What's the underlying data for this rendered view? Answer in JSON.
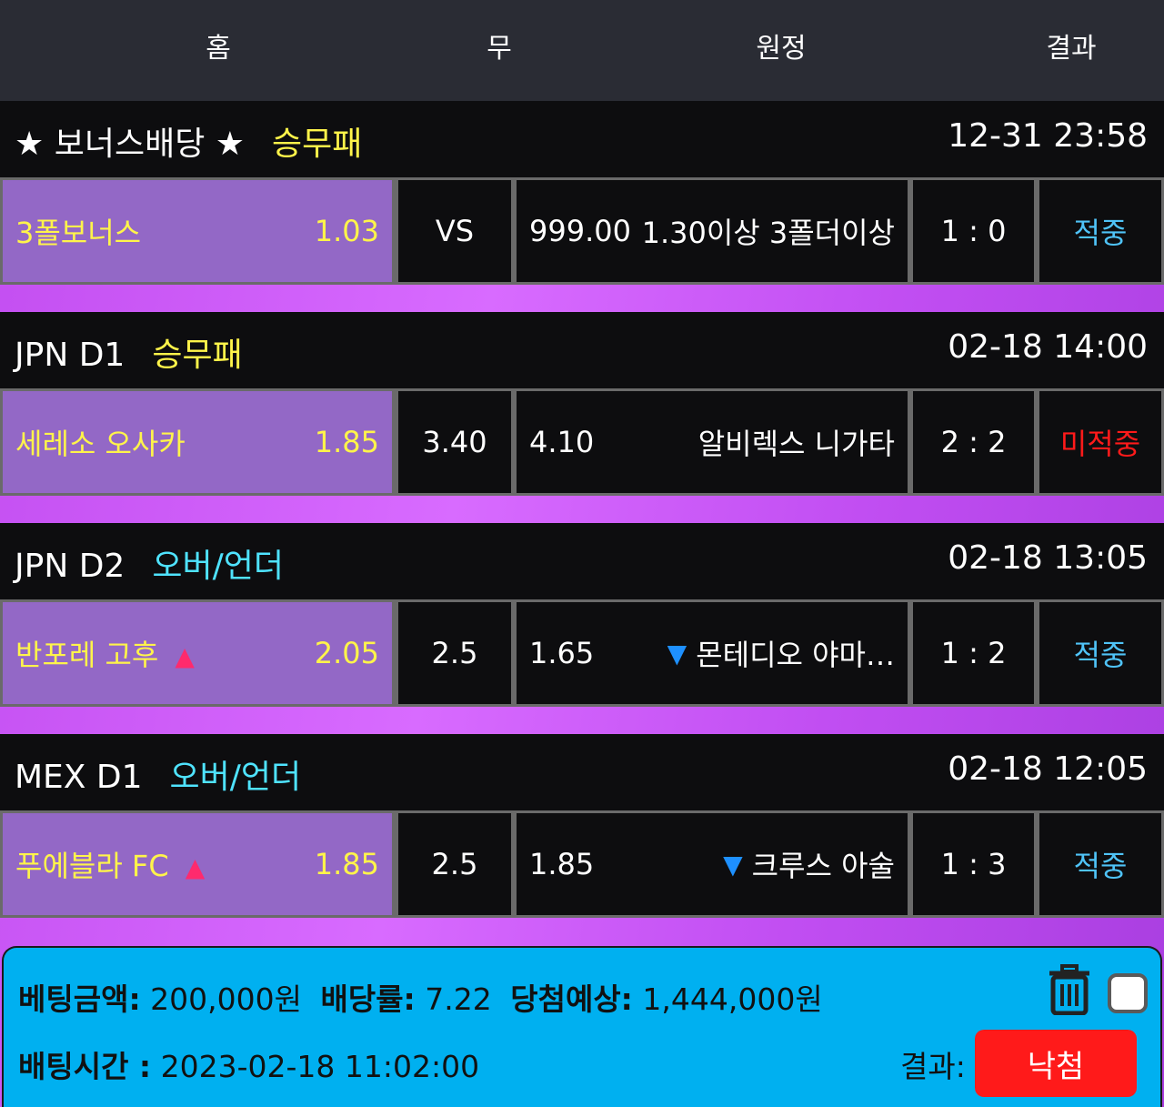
{
  "header": {
    "home": "홈",
    "draw": "무",
    "away": "원정",
    "result": "결과"
  },
  "colors": {
    "win": "#4fc3f7",
    "loss": "#ff1a1a",
    "wdl": "#fff44a",
    "ou": "#4fe3ff"
  },
  "matches": [
    {
      "league": "★ 보너스배당 ★",
      "bet_type": "승무패",
      "bet_type_kind": "wdl",
      "time": "12-31 23:58",
      "home": "3폴보너스",
      "home_arrow": "",
      "home_odds": "1.03",
      "draw": "VS",
      "away_odds": "999.00",
      "away_arrow": "",
      "away": "1.30이상 3폴더이상",
      "score": "1 : 0",
      "result": "적중",
      "result_kind": "win"
    },
    {
      "league": "JPN D1",
      "bet_type": "승무패",
      "bet_type_kind": "wdl",
      "time": "02-18 14:00",
      "home": "세레소 오사카",
      "home_arrow": "",
      "home_odds": "1.85",
      "draw": "3.40",
      "away_odds": "4.10",
      "away_arrow": "",
      "away": "알비렉스 니가타",
      "score": "2 : 2",
      "result": "미적중",
      "result_kind": "loss"
    },
    {
      "league": "JPN D2",
      "bet_type": "오버/언더",
      "bet_type_kind": "ou",
      "time": "02-18 13:05",
      "home": "반포레 고후",
      "home_arrow": "▲",
      "home_odds": "2.05",
      "draw": "2.5",
      "away_odds": "1.65",
      "away_arrow": "▼",
      "away": "몬테디오 야마…",
      "score": "1 : 2",
      "result": "적중",
      "result_kind": "win"
    },
    {
      "league": "MEX D1",
      "bet_type": "오버/언더",
      "bet_type_kind": "ou",
      "time": "02-18 12:05",
      "home": "푸에블라 FC",
      "home_arrow": "▲",
      "home_odds": "1.85",
      "draw": "2.5",
      "away_odds": "1.85",
      "away_arrow": "▼",
      "away": "크루스 아술",
      "score": "1 : 3",
      "result": "적중",
      "result_kind": "win"
    }
  ],
  "summary": {
    "bet_amount_label": "베팅금액:",
    "bet_amount": "200,000원",
    "odds_label": "배당률:",
    "odds": "7.22",
    "expected_label": "당첨예상:",
    "expected": "1,444,000원",
    "time_label": "배팅시간 :",
    "time": "2023-02-18 11:02:00",
    "result_label": "결과:",
    "result_button": "낙첨"
  }
}
